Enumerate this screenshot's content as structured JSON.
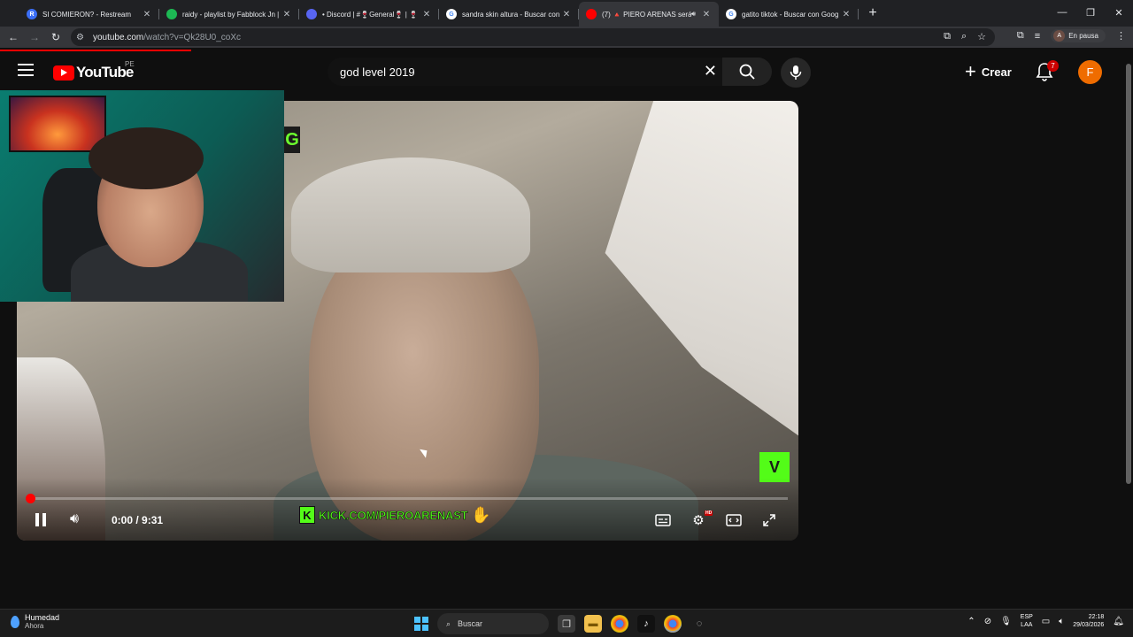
{
  "browser": {
    "tabs": [
      {
        "title": "SI COMIERON? - Restream",
        "favicon_color": "#3b6ef5",
        "favicon_letter": "R",
        "active": false
      },
      {
        "title": "raidy - playlist by Fabblock Jn |",
        "favicon_color": "#1db954",
        "favicon_letter": "",
        "active": false
      },
      {
        "title": "• Discord | #🍷General🍷 | 🍷",
        "favicon_color": "#5865f2",
        "favicon_letter": "",
        "active": false
      },
      {
        "title": "sandra skin altura - Buscar con",
        "favicon_color": "#ffffff",
        "favicon_letter": "G",
        "active": false
      },
      {
        "title": "(7) 🔺 PIERO ARENAS será",
        "favicon_color": "#ff0000",
        "favicon_letter": "",
        "active": true
      },
      {
        "title": "gatito tiktok - Buscar con Goog",
        "favicon_color": "#ffffff",
        "favicon_letter": "G",
        "active": false
      }
    ],
    "new_tab": "+",
    "url_host": "youtube.com",
    "url_rest": "/watch?v=Qk28U0_coXc",
    "profile_letter": "A",
    "profile_status": "En pausa"
  },
  "masthead": {
    "logo_text": "YouTube",
    "country_code": "PE",
    "search_value": "god level 2019",
    "create_label": "Crear",
    "notification_count": "7",
    "avatar_letter": "F"
  },
  "player": {
    "time": "0:00 / 9:31",
    "progress_fraction": 0.0,
    "overlay_badge_left": "G",
    "overlay_badge_right": "V",
    "kick_letter": "K",
    "kick_text": "KICK.COM/PIEROARENAST",
    "settings_badge": "HD"
  },
  "taskbar": {
    "weather_title": "Humedad",
    "weather_sub": "Ahora",
    "search_placeholder": "Buscar",
    "lang_line1": "ESP",
    "lang_line2": "LAA",
    "time": "22:18",
    "date": "29/03/2026"
  },
  "colors": {
    "accent_red": "#ff0000",
    "kick_green": "#53fc18",
    "avatar_orange": "#ef6c00"
  }
}
